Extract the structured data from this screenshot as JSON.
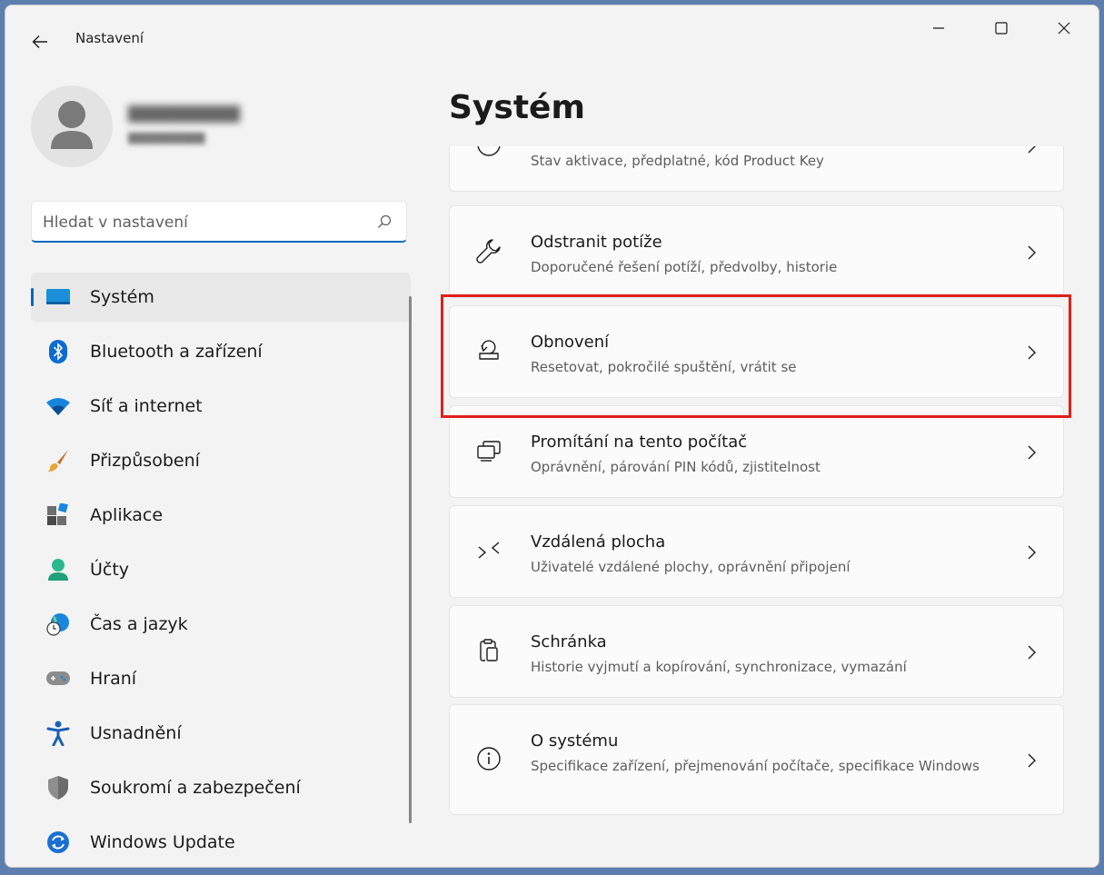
{
  "window": {
    "app_title": "Nastavení"
  },
  "search": {
    "placeholder": "Hledat v nastavení"
  },
  "nav": {
    "items": [
      {
        "label": "Systém",
        "icon": "system-icon"
      },
      {
        "label": "Bluetooth a zařízení",
        "icon": "bluetooth-icon"
      },
      {
        "label": "Síť a internet",
        "icon": "wifi-icon"
      },
      {
        "label": "Přizpůsobení",
        "icon": "brush-icon"
      },
      {
        "label": "Aplikace",
        "icon": "apps-icon"
      },
      {
        "label": "Účty",
        "icon": "accounts-icon"
      },
      {
        "label": "Čas a jazyk",
        "icon": "time-language-icon"
      },
      {
        "label": "Hraní",
        "icon": "gaming-icon"
      },
      {
        "label": "Usnadnění",
        "icon": "accessibility-icon"
      },
      {
        "label": "Soukromí a zabezpečení",
        "icon": "shield-icon"
      },
      {
        "label": "Windows Update",
        "icon": "windows-update-icon"
      }
    ]
  },
  "main": {
    "title": "Systém",
    "cards": [
      {
        "title": "",
        "desc": "Stav aktivace, předplatné, kód Product Key",
        "icon": "activation-icon"
      },
      {
        "title": "Odstranit potíže",
        "desc": "Doporučené řešení potíží, předvolby, historie",
        "icon": "wrench-icon"
      },
      {
        "title": "Obnovení",
        "desc": "Resetovat, pokročilé spuštění, vrátit se",
        "icon": "recovery-icon"
      },
      {
        "title": "Promítání na tento počítač",
        "desc": "Oprávnění, párování PIN kódů, zjistitelnost",
        "icon": "projection-icon"
      },
      {
        "title": "Vzdálená plocha",
        "desc": "Uživatelé vzdálené plochy, oprávnění připojení",
        "icon": "remote-desktop-icon"
      },
      {
        "title": "Schránka",
        "desc": "Historie vyjmutí a kopírování, synchronizace, vymazání",
        "icon": "clipboard-icon"
      },
      {
        "title": "O systému",
        "desc": "Specifikace zařízení, přejmenování počítače, specifikace Windows",
        "icon": "info-icon"
      }
    ]
  },
  "colors": {
    "accent": "#0067c0",
    "highlight": "#e0201c"
  }
}
